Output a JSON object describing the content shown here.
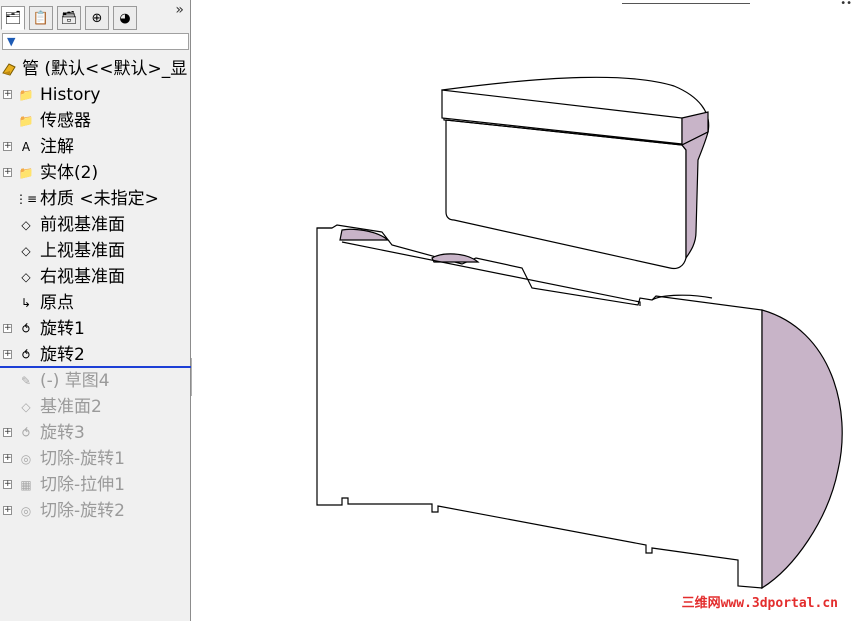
{
  "panel_tabs": [
    {
      "name": "feature-manager-tab",
      "icon": "feature-tree-icon",
      "glyph": "🗂"
    },
    {
      "name": "property-manager-tab",
      "icon": "property-manager-icon",
      "glyph": "📋"
    },
    {
      "name": "configuration-manager-tab",
      "icon": "configuration-icon",
      "glyph": "🗃"
    },
    {
      "name": "dimxpert-tab",
      "icon": "dimxpert-icon",
      "glyph": "⊕"
    },
    {
      "name": "display-manager-tab",
      "icon": "display-manager-icon",
      "glyph": "◕"
    }
  ],
  "expand_label": "»",
  "tree": {
    "root_label": "管  (默认<<默认>_显",
    "items": [
      {
        "label": "History",
        "icon": "history-folder-icon",
        "expandable": true,
        "dim": false
      },
      {
        "label": "传感器",
        "icon": "sensor-icon",
        "expandable": false,
        "dim": false
      },
      {
        "label": "注解",
        "icon": "annotation-icon",
        "expandable": true,
        "dim": false
      },
      {
        "label": "实体(2)",
        "icon": "solid-bodies-icon",
        "expandable": true,
        "dim": false
      },
      {
        "label": "材质 <未指定>",
        "icon": "material-icon",
        "expandable": false,
        "dim": false
      },
      {
        "label": "前视基准面",
        "icon": "plane-icon",
        "expandable": false,
        "dim": false
      },
      {
        "label": "上视基准面",
        "icon": "plane-icon",
        "expandable": false,
        "dim": false
      },
      {
        "label": "右视基准面",
        "icon": "plane-icon",
        "expandable": false,
        "dim": false
      },
      {
        "label": "原点",
        "icon": "origin-icon",
        "expandable": false,
        "dim": false
      },
      {
        "label": "旋转1",
        "icon": "revolve-icon",
        "expandable": true,
        "dim": false
      },
      {
        "label": "旋转2",
        "icon": "revolve-icon",
        "expandable": true,
        "dim": false
      },
      {
        "label": "(-) 草图4",
        "icon": "sketch-icon",
        "expandable": false,
        "dim": true
      },
      {
        "label": "基准面2",
        "icon": "plane-icon",
        "expandable": false,
        "dim": true
      },
      {
        "label": "旋转3",
        "icon": "revolve-icon",
        "expandable": true,
        "dim": true
      },
      {
        "label": "切除-旋转1",
        "icon": "cut-revolve-icon",
        "expandable": true,
        "dim": true
      },
      {
        "label": "切除-拉伸1",
        "icon": "cut-extrude-icon",
        "expandable": true,
        "dim": true
      },
      {
        "label": "切除-旋转2",
        "icon": "cut-revolve-icon",
        "expandable": true,
        "dim": true
      }
    ]
  },
  "watermark": "三维网www.3dportal.cn",
  "colors": {
    "panel_bg": "#f0f0f0",
    "rollback_bar": "#1c3fd6",
    "model_face": "#c8b4c8",
    "model_edge": "#000000",
    "watermark": "#e32d2d"
  }
}
